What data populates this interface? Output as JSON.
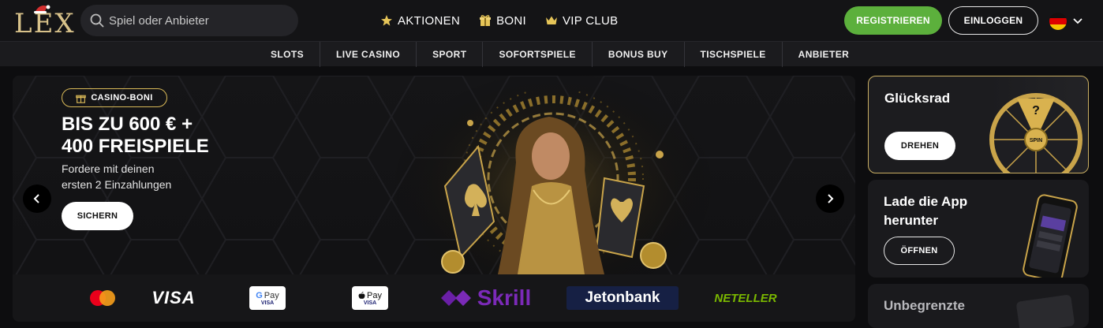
{
  "header": {
    "logo_text": "LEX",
    "search_placeholder": "Spiel oder Anbieter",
    "nav": [
      {
        "label": "AKTIONEN",
        "icon": "star-icon"
      },
      {
        "label": "BONI",
        "icon": "gift-icon"
      },
      {
        "label": "VIP CLUB",
        "icon": "crown-icon"
      }
    ],
    "register_label": "REGISTRIEREN",
    "login_label": "EINLOGGEN",
    "language_flag": "de-flag-icon"
  },
  "categories": [
    "SLOTS",
    "LIVE CASINO",
    "SPORT",
    "SOFORTSPIELE",
    "BONUS BUY",
    "TISCHSPIELE",
    "ANBIETER"
  ],
  "hero": {
    "badge": "CASINO-BONI",
    "title_line1": "BIS ZU 600 € +",
    "title_line2": "400 FREISPIELE",
    "subtitle_line1": "Fordere mit deinen",
    "subtitle_line2": "ersten 2 Einzahlungen",
    "cta": "SICHERN"
  },
  "payments": {
    "visa": "VISA",
    "gpay": "Pay",
    "gpay_sub": "VISA",
    "applepay": "Pay",
    "applepay_sub": "VISA",
    "skrill": "Skrill",
    "jetonbank": "Jetonbank",
    "neteller": "NETELLER"
  },
  "side": {
    "wheel_title": "Glücksrad",
    "wheel_btn": "DREHEN",
    "wheel_center": "SPIN",
    "wheel_mark": "?",
    "app_title_line1": "Lade die App",
    "app_title_line2": "herunter",
    "app_btn": "ÖFFNEN",
    "third_title": "Unbegrenzte"
  },
  "colors": {
    "accent_green": "#5cb03c",
    "gold": "#d8b857",
    "background": "#0d0d0f"
  }
}
